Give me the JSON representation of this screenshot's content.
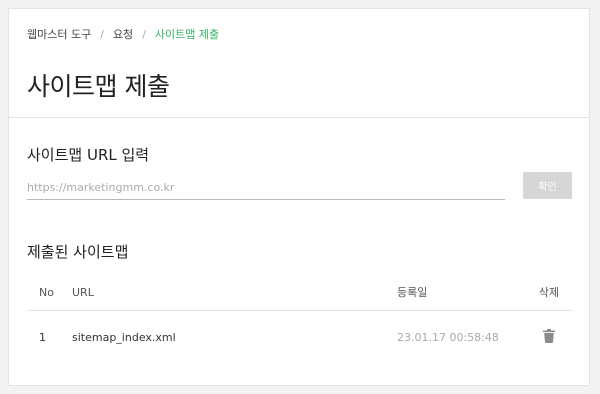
{
  "breadcrumb": {
    "items": [
      "웹마스터 도구",
      "요청"
    ],
    "current": "사이트맵 제출"
  },
  "page_title": "사이트맵 제출",
  "submit_section": {
    "title": "사이트맵 URL 입력",
    "input_placeholder": "https://marketingmm.co.kr",
    "input_value": "",
    "confirm_label": "확인"
  },
  "list_section": {
    "title": "제출된 사이트맵",
    "columns": {
      "no": "No",
      "url": "URL",
      "date": "등록일",
      "delete": "삭제"
    },
    "rows": [
      {
        "no": "1",
        "url": "sitemap_index.xml",
        "date": "23.01.17 00:58:48",
        "delete_icon": "trash-icon"
      }
    ]
  },
  "colors": {
    "breadcrumb_current": "#3bb26b",
    "confirm_button_bg": "#d6d6d6",
    "date_text": "#aaaaaa",
    "trash_icon": "#8a8a8a"
  }
}
